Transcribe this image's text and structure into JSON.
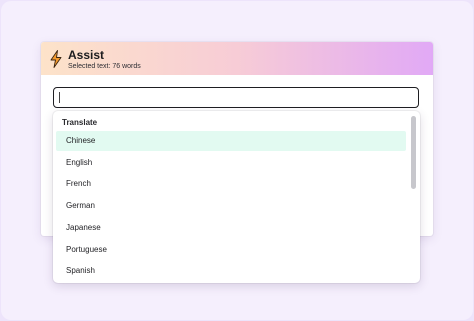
{
  "assist": {
    "title": "Assist",
    "subtitle": "Selected text: 76 words",
    "icon": "lightning-bolt-icon",
    "colors": {
      "header_gradient": [
        "#fde3c9",
        "#f7ccd6",
        "#e1a9f6"
      ],
      "bolt_fill": "#f39a2e",
      "selected_option_bg": "#e2faf1"
    }
  },
  "search": {
    "value": "",
    "placeholder": ""
  },
  "dropdown": {
    "section_label": "Translate",
    "options": [
      {
        "label": "Chinese",
        "selected": true
      },
      {
        "label": "English",
        "selected": false
      },
      {
        "label": "French",
        "selected": false
      },
      {
        "label": "German",
        "selected": false
      },
      {
        "label": "Japanese",
        "selected": false
      },
      {
        "label": "Portuguese",
        "selected": false
      },
      {
        "label": "Spanish",
        "selected": false
      }
    ]
  }
}
